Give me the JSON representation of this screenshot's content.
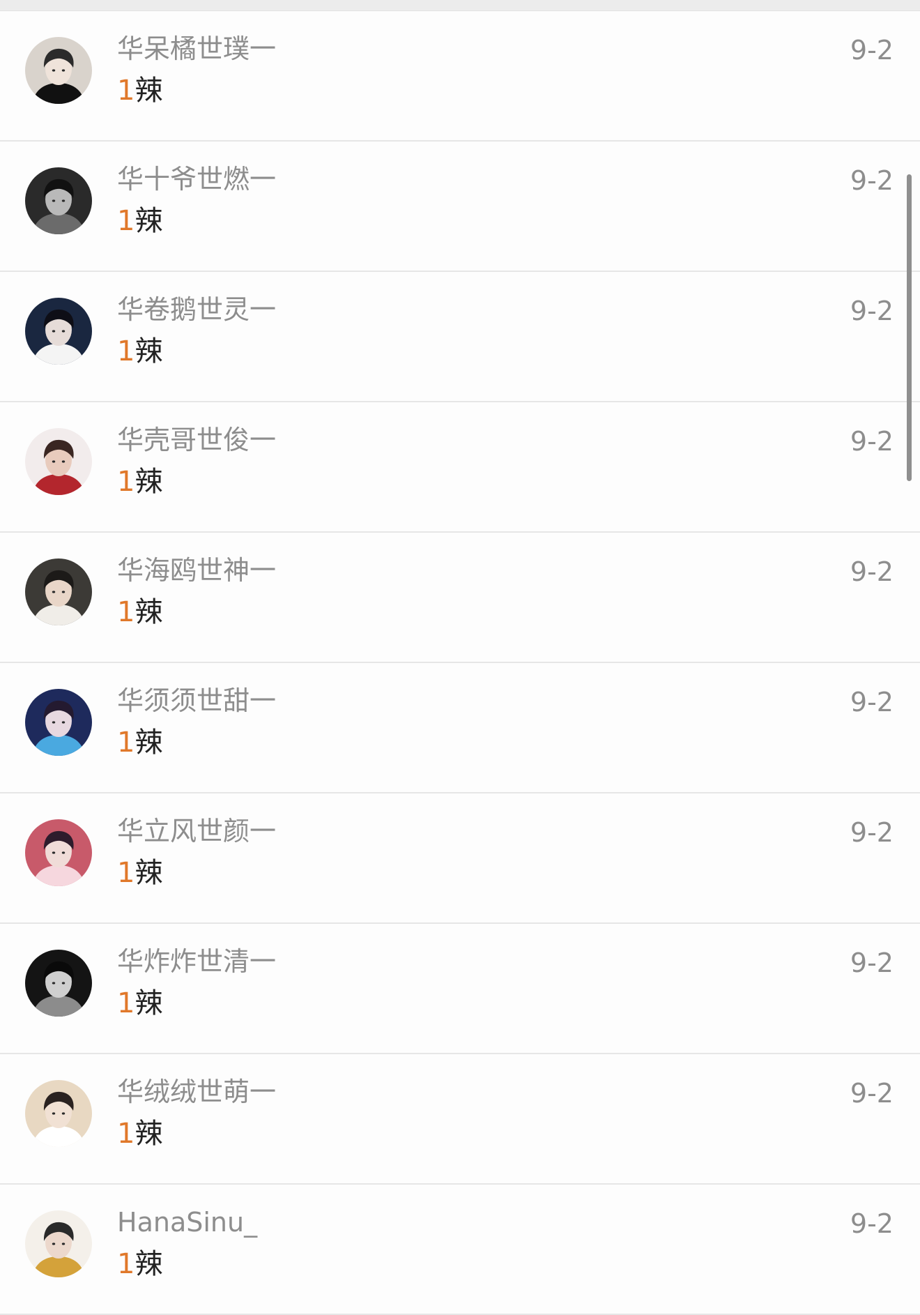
{
  "list": {
    "items": [
      {
        "name": "华呆橘世璞一",
        "count": "1",
        "label": "辣",
        "date": "9-2",
        "avatar": {
          "bg": "#d9d3cc",
          "skin": "#efe3da",
          "hair": "#2b2b2b",
          "accent": "#111111"
        }
      },
      {
        "name": "华十爷世燃一",
        "count": "1",
        "label": "辣",
        "date": "9-2",
        "avatar": {
          "bg": "#2a2a2a",
          "skin": "#b9b9b9",
          "hair": "#111111",
          "accent": "#6b6b6b"
        }
      },
      {
        "name": "华卷鹅世灵一",
        "count": "1",
        "label": "辣",
        "date": "9-2",
        "avatar": {
          "bg": "#1a2740",
          "skin": "#e6dcd8",
          "hair": "#0e0e16",
          "accent": "#f4f4f4"
        }
      },
      {
        "name": "华壳哥世俊一",
        "count": "1",
        "label": "辣",
        "date": "9-2",
        "avatar": {
          "bg": "#f2ecec",
          "skin": "#e8cbbd",
          "hair": "#3a2622",
          "accent": "#b3262d"
        }
      },
      {
        "name": "华海鸥世神一",
        "count": "1",
        "label": "辣",
        "date": "9-2",
        "avatar": {
          "bg": "#3c3a36",
          "skin": "#e9d6c8",
          "hair": "#1c1a18",
          "accent": "#f0ede8"
        }
      },
      {
        "name": "华须须世甜一",
        "count": "1",
        "label": "辣",
        "date": "9-2",
        "avatar": {
          "bg": "#1e2a5c",
          "skin": "#e7d8e0",
          "hair": "#241a30",
          "accent": "#4aa9e0"
        }
      },
      {
        "name": "华立风世颜一",
        "count": "1",
        "label": "辣",
        "date": "9-2",
        "avatar": {
          "bg": "#c85a6a",
          "skin": "#f0dcd8",
          "hair": "#2e1c2c",
          "accent": "#f6d7de"
        }
      },
      {
        "name": "华炸炸世清一",
        "count": "1",
        "label": "辣",
        "date": "9-2",
        "avatar": {
          "bg": "#141414",
          "skin": "#cfcfcf",
          "hair": "#0a0a0a",
          "accent": "#8c8c8c"
        }
      },
      {
        "name": "华绒绒世萌一",
        "count": "1",
        "label": "辣",
        "date": "9-2",
        "avatar": {
          "bg": "#e8d8c2",
          "skin": "#f1e1d4",
          "hair": "#2a2220",
          "accent": "#ffffff"
        }
      },
      {
        "name": "HanaSinu_",
        "count": "1",
        "label": "辣",
        "date": "9-2",
        "avatar": {
          "bg": "#f4f0ea",
          "skin": "#ecd8cc",
          "hair": "#2a2a2a",
          "accent": "#d4a23a"
        }
      }
    ]
  },
  "colors": {
    "count": "#e0782a",
    "label": "#222222",
    "muted_text": "#8d8d8d",
    "divider": "#e6e6e6",
    "background": "#fdfdfd"
  }
}
